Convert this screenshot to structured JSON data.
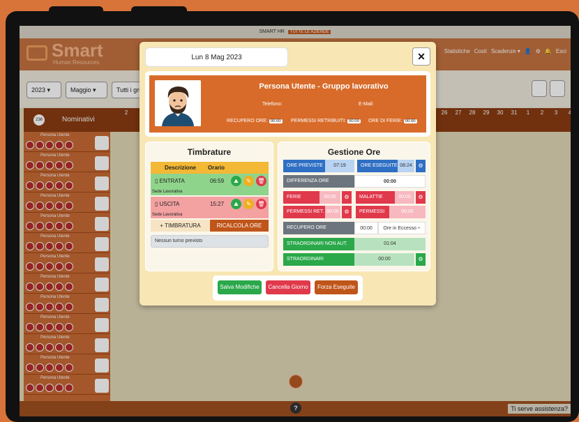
{
  "app": {
    "title": "SMART HR",
    "scope_badge": "TUTTE LE AZIENDE",
    "logo_title": "Smart",
    "logo_subtitle": "Human Resources",
    "menu": [
      "Statistiche",
      "Costi",
      "Scadenze ▾",
      "Esci"
    ]
  },
  "filters": {
    "year": "2023 ▾",
    "month": "Maggio ▾",
    "group": "Tutti i grup"
  },
  "grid": {
    "count_badge": "236",
    "header_label": "Nominativi",
    "row_name": "Persona Utente",
    "days": [
      "2",
      "26",
      "27",
      "28",
      "29",
      "30",
      "31",
      "1",
      "2",
      "3",
      "4"
    ]
  },
  "footer": {
    "help": "?",
    "assist": "Ti serve assistenza?"
  },
  "modal": {
    "date": "Lun 8 Mag 2023",
    "close": "✕",
    "user": {
      "name": "Persona Utente - Gruppo lavorativo",
      "phone_label": "Telefono:",
      "email_label": "E-Mail:",
      "recupero_label": "RECUPERO ORE:",
      "recupero_value": "00:00",
      "permessi_label": "PERMESSI RETRIBUITI:",
      "permessi_value": "00:00",
      "ferie_label": "ORE DI FERIE:",
      "ferie_value": "00:00"
    },
    "timbrature": {
      "title": "Timbrature",
      "col_desc": "Descrizione",
      "col_time": "Orario",
      "entries": [
        {
          "type": "ENTRATA",
          "time": "06:59",
          "sede": "Sede Lavorativa"
        },
        {
          "type": "USCITA",
          "time": "15:27",
          "sede": "Sede Lavorativa"
        }
      ],
      "add_button": "TIMBRATURA",
      "recalc_button": "RICALCOLA ORE",
      "no_shift": "Nessun turno previsto"
    },
    "gestione": {
      "title": "Gestione Ore",
      "ore_previste_label": "ORE PREVISTE",
      "ore_previste_value": "07:19",
      "ore_eseguite_label": "ORE ESEGUITE",
      "ore_eseguite_value": "08:24",
      "differenza_label": "DIFFERENZA ORE",
      "differenza_value": "00:00",
      "ferie_label": "FERIE",
      "ferie_value": "00:00",
      "malattie_label": "MALATTIE",
      "malattie_value": "00:00",
      "permessi_ret_label": "PERMESSI RET.",
      "permessi_ret_value": "00:00",
      "permessi_label": "PERMESSI",
      "permessi_value": "00:00",
      "recupero_label": "RECUPERO ORE",
      "recupero_value": "00:00",
      "recupero_select": "Ore in Eccesso ÷",
      "straord_non_aut_label": "STRAORDINARI NON AUT.",
      "straord_non_aut_value": "01:04",
      "straord_label": "STRAORDINARI",
      "straord_value": "00:00"
    },
    "buttons": {
      "save": "Salva Modifiche",
      "cancel": "Cancella Giorno",
      "force": "Forza Eseguite"
    },
    "colors": {
      "blue": "#2f6fc4",
      "red": "#e0394b",
      "green": "#2aa84a",
      "gray": "#6c757d",
      "orange": "#d86b2a"
    }
  }
}
